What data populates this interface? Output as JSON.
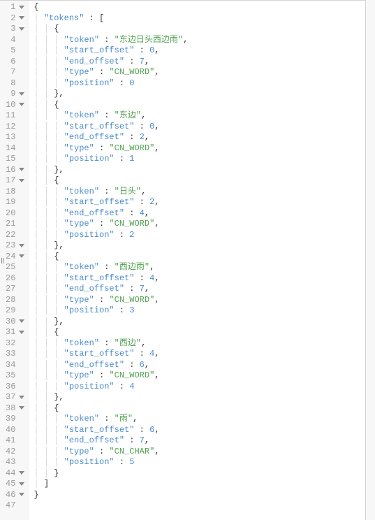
{
  "lines": [
    {
      "num": "1",
      "fold": true,
      "indent": 0,
      "tokens": [
        {
          "t": "{",
          "c": "p"
        }
      ]
    },
    {
      "num": "2",
      "fold": true,
      "indent": 1,
      "tokens": [
        {
          "t": "\"tokens\"",
          "c": "k"
        },
        {
          "t": " : ",
          "c": "p"
        },
        {
          "t": "[",
          "c": "p"
        }
      ]
    },
    {
      "num": "3",
      "fold": true,
      "indent": 2,
      "tokens": [
        {
          "t": "{",
          "c": "p"
        }
      ]
    },
    {
      "num": "4",
      "fold": false,
      "indent": 3,
      "tokens": [
        {
          "t": "\"token\"",
          "c": "k"
        },
        {
          "t": " : ",
          "c": "p"
        },
        {
          "t": "\"东边日头西边雨\"",
          "c": "s"
        },
        {
          "t": ",",
          "c": "p"
        }
      ]
    },
    {
      "num": "5",
      "fold": false,
      "indent": 3,
      "tokens": [
        {
          "t": "\"start_offset\"",
          "c": "k"
        },
        {
          "t": " : ",
          "c": "p"
        },
        {
          "t": "0",
          "c": "n"
        },
        {
          "t": ",",
          "c": "p"
        }
      ]
    },
    {
      "num": "6",
      "fold": false,
      "indent": 3,
      "tokens": [
        {
          "t": "\"end_offset\"",
          "c": "k"
        },
        {
          "t": " : ",
          "c": "p"
        },
        {
          "t": "7",
          "c": "n"
        },
        {
          "t": ",",
          "c": "p"
        }
      ]
    },
    {
      "num": "7",
      "fold": false,
      "indent": 3,
      "tokens": [
        {
          "t": "\"type\"",
          "c": "k"
        },
        {
          "t": " : ",
          "c": "p"
        },
        {
          "t": "\"CN_WORD\"",
          "c": "s"
        },
        {
          "t": ",",
          "c": "p"
        }
      ]
    },
    {
      "num": "8",
      "fold": false,
      "indent": 3,
      "tokens": [
        {
          "t": "\"position\"",
          "c": "k"
        },
        {
          "t": " : ",
          "c": "p"
        },
        {
          "t": "0",
          "c": "n"
        }
      ]
    },
    {
      "num": "9",
      "fold": true,
      "indent": 2,
      "tokens": [
        {
          "t": "}",
          "c": "p"
        },
        {
          "t": ",",
          "c": "p"
        }
      ]
    },
    {
      "num": "10",
      "fold": true,
      "indent": 2,
      "tokens": [
        {
          "t": "{",
          "c": "p"
        }
      ]
    },
    {
      "num": "11",
      "fold": false,
      "indent": 3,
      "tokens": [
        {
          "t": "\"token\"",
          "c": "k"
        },
        {
          "t": " : ",
          "c": "p"
        },
        {
          "t": "\"东边\"",
          "c": "s"
        },
        {
          "t": ",",
          "c": "p"
        }
      ]
    },
    {
      "num": "12",
      "fold": false,
      "indent": 3,
      "tokens": [
        {
          "t": "\"start_offset\"",
          "c": "k"
        },
        {
          "t": " : ",
          "c": "p"
        },
        {
          "t": "0",
          "c": "n"
        },
        {
          "t": ",",
          "c": "p"
        }
      ]
    },
    {
      "num": "13",
      "fold": false,
      "indent": 3,
      "tokens": [
        {
          "t": "\"end_offset\"",
          "c": "k"
        },
        {
          "t": " : ",
          "c": "p"
        },
        {
          "t": "2",
          "c": "n"
        },
        {
          "t": ",",
          "c": "p"
        }
      ]
    },
    {
      "num": "14",
      "fold": false,
      "indent": 3,
      "tokens": [
        {
          "t": "\"type\"",
          "c": "k"
        },
        {
          "t": " : ",
          "c": "p"
        },
        {
          "t": "\"CN_WORD\"",
          "c": "s"
        },
        {
          "t": ",",
          "c": "p"
        }
      ]
    },
    {
      "num": "15",
      "fold": false,
      "indent": 3,
      "tokens": [
        {
          "t": "\"position\"",
          "c": "k"
        },
        {
          "t": " : ",
          "c": "p"
        },
        {
          "t": "1",
          "c": "n"
        }
      ]
    },
    {
      "num": "16",
      "fold": true,
      "indent": 2,
      "tokens": [
        {
          "t": "}",
          "c": "p"
        },
        {
          "t": ",",
          "c": "p"
        }
      ]
    },
    {
      "num": "17",
      "fold": true,
      "indent": 2,
      "tokens": [
        {
          "t": "{",
          "c": "p"
        }
      ]
    },
    {
      "num": "18",
      "fold": false,
      "indent": 3,
      "tokens": [
        {
          "t": "\"token\"",
          "c": "k"
        },
        {
          "t": " : ",
          "c": "p"
        },
        {
          "t": "\"日头\"",
          "c": "s"
        },
        {
          "t": ",",
          "c": "p"
        }
      ]
    },
    {
      "num": "19",
      "fold": false,
      "indent": 3,
      "tokens": [
        {
          "t": "\"start_offset\"",
          "c": "k"
        },
        {
          "t": " : ",
          "c": "p"
        },
        {
          "t": "2",
          "c": "n"
        },
        {
          "t": ",",
          "c": "p"
        }
      ]
    },
    {
      "num": "20",
      "fold": false,
      "indent": 3,
      "tokens": [
        {
          "t": "\"end_offset\"",
          "c": "k"
        },
        {
          "t": " : ",
          "c": "p"
        },
        {
          "t": "4",
          "c": "n"
        },
        {
          "t": ",",
          "c": "p"
        }
      ]
    },
    {
      "num": "21",
      "fold": false,
      "indent": 3,
      "tokens": [
        {
          "t": "\"type\"",
          "c": "k"
        },
        {
          "t": " : ",
          "c": "p"
        },
        {
          "t": "\"CN_WORD\"",
          "c": "s"
        },
        {
          "t": ",",
          "c": "p"
        }
      ]
    },
    {
      "num": "22",
      "fold": false,
      "indent": 3,
      "tokens": [
        {
          "t": "\"position\"",
          "c": "k"
        },
        {
          "t": " : ",
          "c": "p"
        },
        {
          "t": "2",
          "c": "n"
        }
      ]
    },
    {
      "num": "23",
      "fold": true,
      "indent": 2,
      "tokens": [
        {
          "t": "}",
          "c": "p"
        },
        {
          "t": ",",
          "c": "p"
        }
      ]
    },
    {
      "num": "24",
      "fold": true,
      "indent": 2,
      "tokens": [
        {
          "t": "{",
          "c": "p"
        }
      ]
    },
    {
      "num": "25",
      "fold": false,
      "indent": 3,
      "tokens": [
        {
          "t": "\"token\"",
          "c": "k"
        },
        {
          "t": " : ",
          "c": "p"
        },
        {
          "t": "\"西边雨\"",
          "c": "s"
        },
        {
          "t": ",",
          "c": "p"
        }
      ]
    },
    {
      "num": "26",
      "fold": false,
      "indent": 3,
      "tokens": [
        {
          "t": "\"start_offset\"",
          "c": "k"
        },
        {
          "t": " : ",
          "c": "p"
        },
        {
          "t": "4",
          "c": "n"
        },
        {
          "t": ",",
          "c": "p"
        }
      ]
    },
    {
      "num": "27",
      "fold": false,
      "indent": 3,
      "tokens": [
        {
          "t": "\"end_offset\"",
          "c": "k"
        },
        {
          "t": " : ",
          "c": "p"
        },
        {
          "t": "7",
          "c": "n"
        },
        {
          "t": ",",
          "c": "p"
        }
      ]
    },
    {
      "num": "28",
      "fold": false,
      "indent": 3,
      "tokens": [
        {
          "t": "\"type\"",
          "c": "k"
        },
        {
          "t": " : ",
          "c": "p"
        },
        {
          "t": "\"CN_WORD\"",
          "c": "s"
        },
        {
          "t": ",",
          "c": "p"
        }
      ]
    },
    {
      "num": "29",
      "fold": false,
      "indent": 3,
      "tokens": [
        {
          "t": "\"position\"",
          "c": "k"
        },
        {
          "t": " : ",
          "c": "p"
        },
        {
          "t": "3",
          "c": "n"
        }
      ]
    },
    {
      "num": "30",
      "fold": true,
      "indent": 2,
      "tokens": [
        {
          "t": "}",
          "c": "p"
        },
        {
          "t": ",",
          "c": "p"
        }
      ]
    },
    {
      "num": "31",
      "fold": true,
      "indent": 2,
      "tokens": [
        {
          "t": "{",
          "c": "p"
        }
      ]
    },
    {
      "num": "32",
      "fold": false,
      "indent": 3,
      "tokens": [
        {
          "t": "\"token\"",
          "c": "k"
        },
        {
          "t": " : ",
          "c": "p"
        },
        {
          "t": "\"西边\"",
          "c": "s"
        },
        {
          "t": ",",
          "c": "p"
        }
      ]
    },
    {
      "num": "33",
      "fold": false,
      "indent": 3,
      "tokens": [
        {
          "t": "\"start_offset\"",
          "c": "k"
        },
        {
          "t": " : ",
          "c": "p"
        },
        {
          "t": "4",
          "c": "n"
        },
        {
          "t": ",",
          "c": "p"
        }
      ]
    },
    {
      "num": "34",
      "fold": false,
      "indent": 3,
      "tokens": [
        {
          "t": "\"end_offset\"",
          "c": "k"
        },
        {
          "t": " : ",
          "c": "p"
        },
        {
          "t": "6",
          "c": "n"
        },
        {
          "t": ",",
          "c": "p"
        }
      ]
    },
    {
      "num": "35",
      "fold": false,
      "indent": 3,
      "tokens": [
        {
          "t": "\"type\"",
          "c": "k"
        },
        {
          "t": " : ",
          "c": "p"
        },
        {
          "t": "\"CN_WORD\"",
          "c": "s"
        },
        {
          "t": ",",
          "c": "p"
        }
      ]
    },
    {
      "num": "36",
      "fold": false,
      "indent": 3,
      "tokens": [
        {
          "t": "\"position\"",
          "c": "k"
        },
        {
          "t": " : ",
          "c": "p"
        },
        {
          "t": "4",
          "c": "n"
        }
      ]
    },
    {
      "num": "37",
      "fold": true,
      "indent": 2,
      "tokens": [
        {
          "t": "}",
          "c": "p"
        },
        {
          "t": ",",
          "c": "p"
        }
      ]
    },
    {
      "num": "38",
      "fold": true,
      "indent": 2,
      "tokens": [
        {
          "t": "{",
          "c": "p"
        }
      ]
    },
    {
      "num": "39",
      "fold": false,
      "indent": 3,
      "tokens": [
        {
          "t": "\"token\"",
          "c": "k"
        },
        {
          "t": " : ",
          "c": "p"
        },
        {
          "t": "\"雨\"",
          "c": "s"
        },
        {
          "t": ",",
          "c": "p"
        }
      ]
    },
    {
      "num": "40",
      "fold": false,
      "indent": 3,
      "tokens": [
        {
          "t": "\"start_offset\"",
          "c": "k"
        },
        {
          "t": " : ",
          "c": "p"
        },
        {
          "t": "6",
          "c": "n"
        },
        {
          "t": ",",
          "c": "p"
        }
      ]
    },
    {
      "num": "41",
      "fold": false,
      "indent": 3,
      "tokens": [
        {
          "t": "\"end_offset\"",
          "c": "k"
        },
        {
          "t": " : ",
          "c": "p"
        },
        {
          "t": "7",
          "c": "n"
        },
        {
          "t": ",",
          "c": "p"
        }
      ]
    },
    {
      "num": "42",
      "fold": false,
      "indent": 3,
      "tokens": [
        {
          "t": "\"type\"",
          "c": "k"
        },
        {
          "t": " : ",
          "c": "p"
        },
        {
          "t": "\"CN_CHAR\"",
          "c": "s"
        },
        {
          "t": ",",
          "c": "p"
        }
      ]
    },
    {
      "num": "43",
      "fold": false,
      "indent": 3,
      "tokens": [
        {
          "t": "\"position\"",
          "c": "k"
        },
        {
          "t": " : ",
          "c": "p"
        },
        {
          "t": "5",
          "c": "n"
        }
      ]
    },
    {
      "num": "44",
      "fold": true,
      "indent": 2,
      "tokens": [
        {
          "t": "}",
          "c": "p"
        }
      ]
    },
    {
      "num": "45",
      "fold": true,
      "indent": 1,
      "tokens": [
        {
          "t": "]",
          "c": "p"
        }
      ]
    },
    {
      "num": "46",
      "fold": true,
      "indent": 0,
      "tokens": [
        {
          "t": "}",
          "c": "p"
        }
      ]
    },
    {
      "num": "47",
      "fold": false,
      "indent": 0,
      "tokens": []
    }
  ]
}
